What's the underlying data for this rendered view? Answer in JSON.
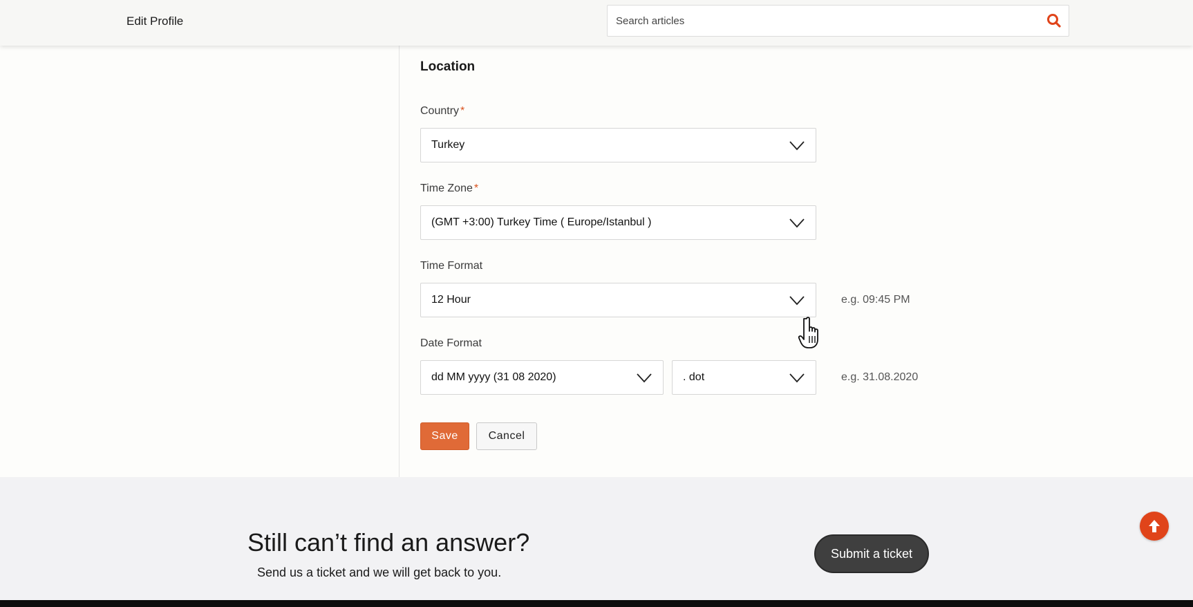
{
  "header": {
    "title": "Edit Profile",
    "search_placeholder": "Search articles"
  },
  "location": {
    "section_title": "Location",
    "country": {
      "label": "Country",
      "required_mark": "*",
      "value": "Turkey"
    },
    "time_zone": {
      "label": "Time Zone",
      "required_mark": "*",
      "value": "(GMT +3:00) Turkey Time ( Europe/Istanbul )"
    },
    "time_format": {
      "label": "Time Format",
      "value": "12 Hour",
      "example": "e.g. 09:45 PM"
    },
    "date_format": {
      "label": "Date Format",
      "value": "dd MM yyyy (31 08 2020)",
      "separator": ". dot",
      "example": "e.g. 31.08.2020"
    }
  },
  "actions": {
    "save_label": "Save",
    "cancel_label": "Cancel"
  },
  "footer": {
    "title": "Still can’t find an answer?",
    "subtitle": "Send us a ticket and we will get back to you.",
    "ticket_label": "Submit a ticket"
  },
  "colors": {
    "accent": "#e06a37",
    "search_icon": "#e0441a",
    "back_to_top": "#e0441a",
    "required": "#d9531e"
  },
  "icons": [
    "search-icon",
    "chevron-down-icon",
    "arrow-up-icon",
    "hand-cursor-icon"
  ]
}
